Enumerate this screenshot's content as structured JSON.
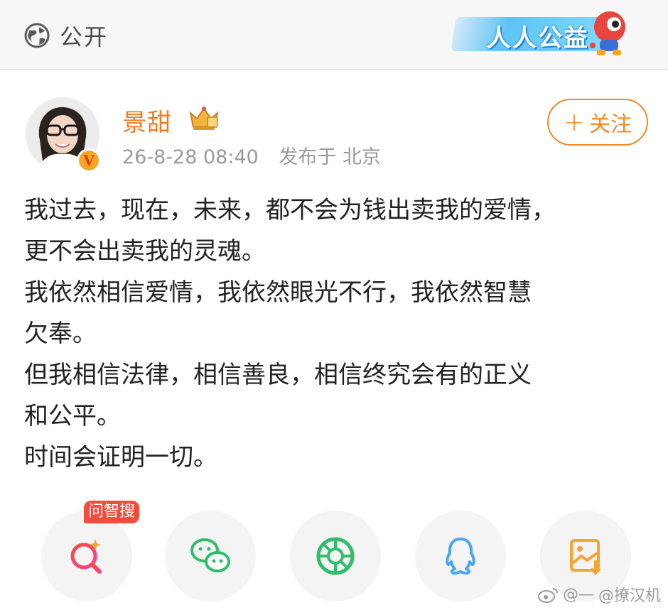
{
  "header": {
    "visibility_label": "公开",
    "charity_badge_text": "人人公益"
  },
  "post": {
    "author": "景甜",
    "timestamp": "26-8-28 08:40",
    "location": "发布于 北京",
    "follow_label": "关注",
    "follow_symbol": "+",
    "verified_mark": "V",
    "lines": [
      "我过去，现在，未来，都不会为钱出卖我的爱情，",
      "更不会出卖我的灵魂。",
      "我依然相信爱情，我依然眼光不行，我依然智慧",
      "欠奉。",
      "但我相信法律，相信善良，相信终究会有的正义",
      "和公平。",
      "时间会证明一切。"
    ]
  },
  "share": {
    "ai_search_tag": "问智搜",
    "buttons": [
      {
        "icon": "ai-search-icon"
      },
      {
        "icon": "wechat-icon"
      },
      {
        "icon": "moments-icon"
      },
      {
        "icon": "qq-icon"
      },
      {
        "icon": "save-image-icon"
      }
    ]
  },
  "watermark": {
    "text": "@—",
    "handle": "@撩汉机"
  },
  "colors": {
    "accent_orange": "#f08a2c",
    "username_orange": "#ef7d1f",
    "ai_red": "#f24c3d",
    "wechat_green": "#2fbd6a",
    "qq_blue": "#4aa6f0",
    "gallery_orange": "#f3a531"
  }
}
